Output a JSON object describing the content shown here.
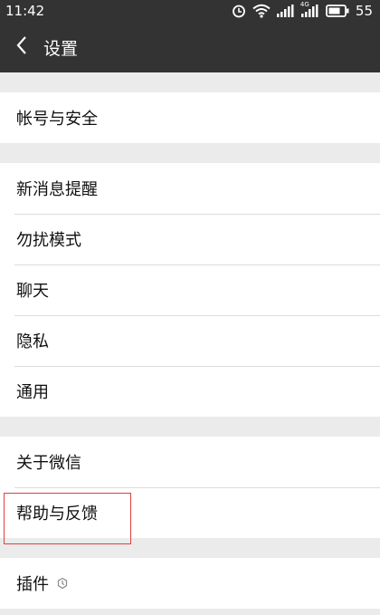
{
  "status": {
    "time": "11:42",
    "battery": "55",
    "network_tag": "4G"
  },
  "header": {
    "title": "设置"
  },
  "groups": [
    {
      "items": [
        {
          "label": "帐号与安全"
        }
      ]
    },
    {
      "items": [
        {
          "label": "新消息提醒"
        },
        {
          "label": "勿扰模式"
        },
        {
          "label": "聊天"
        },
        {
          "label": "隐私"
        },
        {
          "label": "通用"
        }
      ]
    },
    {
      "items": [
        {
          "label": "关于微信"
        },
        {
          "label": "帮助与反馈"
        }
      ]
    },
    {
      "items": [
        {
          "label": "插件"
        }
      ]
    }
  ],
  "colors": {
    "header_bg": "#333333",
    "highlight": "#e04040"
  }
}
